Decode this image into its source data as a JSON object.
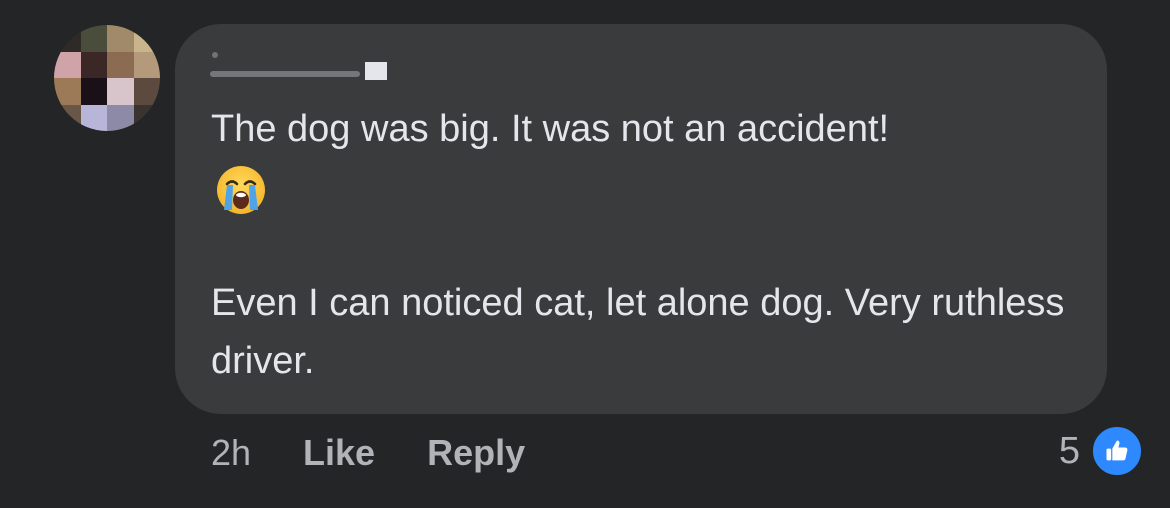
{
  "comment": {
    "author_name": "",
    "lines": [
      "The dog was big. It was not an accident!",
      "Even I can noticed cat, let alone dog. Very ruthless driver."
    ],
    "emoji": "loudly-crying-face"
  },
  "meta": {
    "time": "2h",
    "like_label": "Like",
    "reply_label": "Reply"
  },
  "reactions": {
    "count": "5",
    "type": "like",
    "badge_color": "#2e89ff"
  },
  "colors": {
    "background": "#242526",
    "bubble": "#3a3b3c",
    "text": "#e4e6eb",
    "muted": "#b0b3b8"
  }
}
